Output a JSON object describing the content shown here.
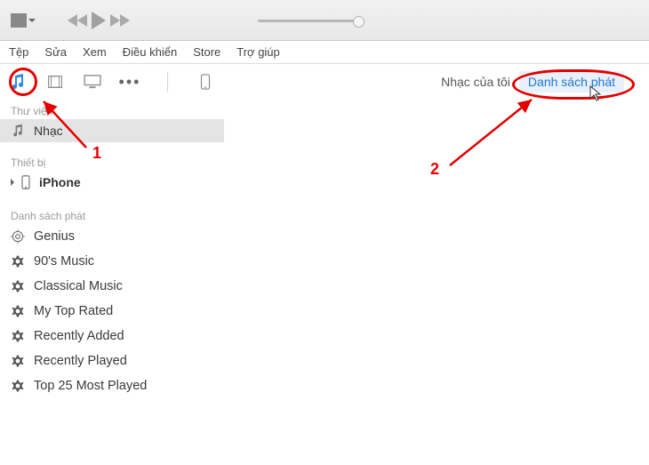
{
  "menubar": {
    "file": "Tệp",
    "edit": "Sửa",
    "view": "Xem",
    "controls": "Điều khiển",
    "store": "Store",
    "help": "Trợ giúp"
  },
  "tabs": {
    "my_music": "Nhạc của tôi",
    "playlists": "Danh sách phát"
  },
  "annotations": {
    "one": "1",
    "two": "2"
  },
  "sidebar": {
    "library_head": "Thư viện",
    "music": "Nhạc",
    "devices_head": "Thiết bị",
    "device": "iPhone",
    "playlists_head": "Danh sách phát",
    "items": [
      {
        "label": "Genius"
      },
      {
        "label": "90's Music"
      },
      {
        "label": "Classical Music"
      },
      {
        "label": "My Top Rated"
      },
      {
        "label": "Recently Added"
      },
      {
        "label": "Recently Played"
      },
      {
        "label": "Top 25 Most Played"
      }
    ]
  }
}
